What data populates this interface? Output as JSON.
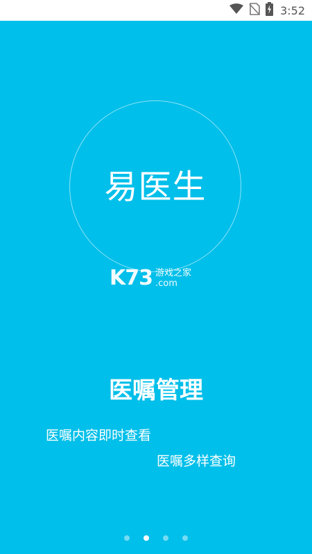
{
  "status_bar": {
    "time": "3:52",
    "icons": [
      "wifi-icon",
      "no-sim-icon",
      "battery-charging-icon"
    ]
  },
  "app": {
    "name": "易医生"
  },
  "watermark": {
    "logo": "K73",
    "site_name": "游戏之家",
    "domain": ".com"
  },
  "feature": {
    "title": "医嘱管理",
    "line1": "医嘱内容即时查看",
    "line2": "医嘱多样查询"
  },
  "pager": {
    "count": 4,
    "active_index": 1
  },
  "colors": {
    "background": "#00bfea",
    "status_bar": "#ffffff",
    "text": "#ffffff"
  }
}
